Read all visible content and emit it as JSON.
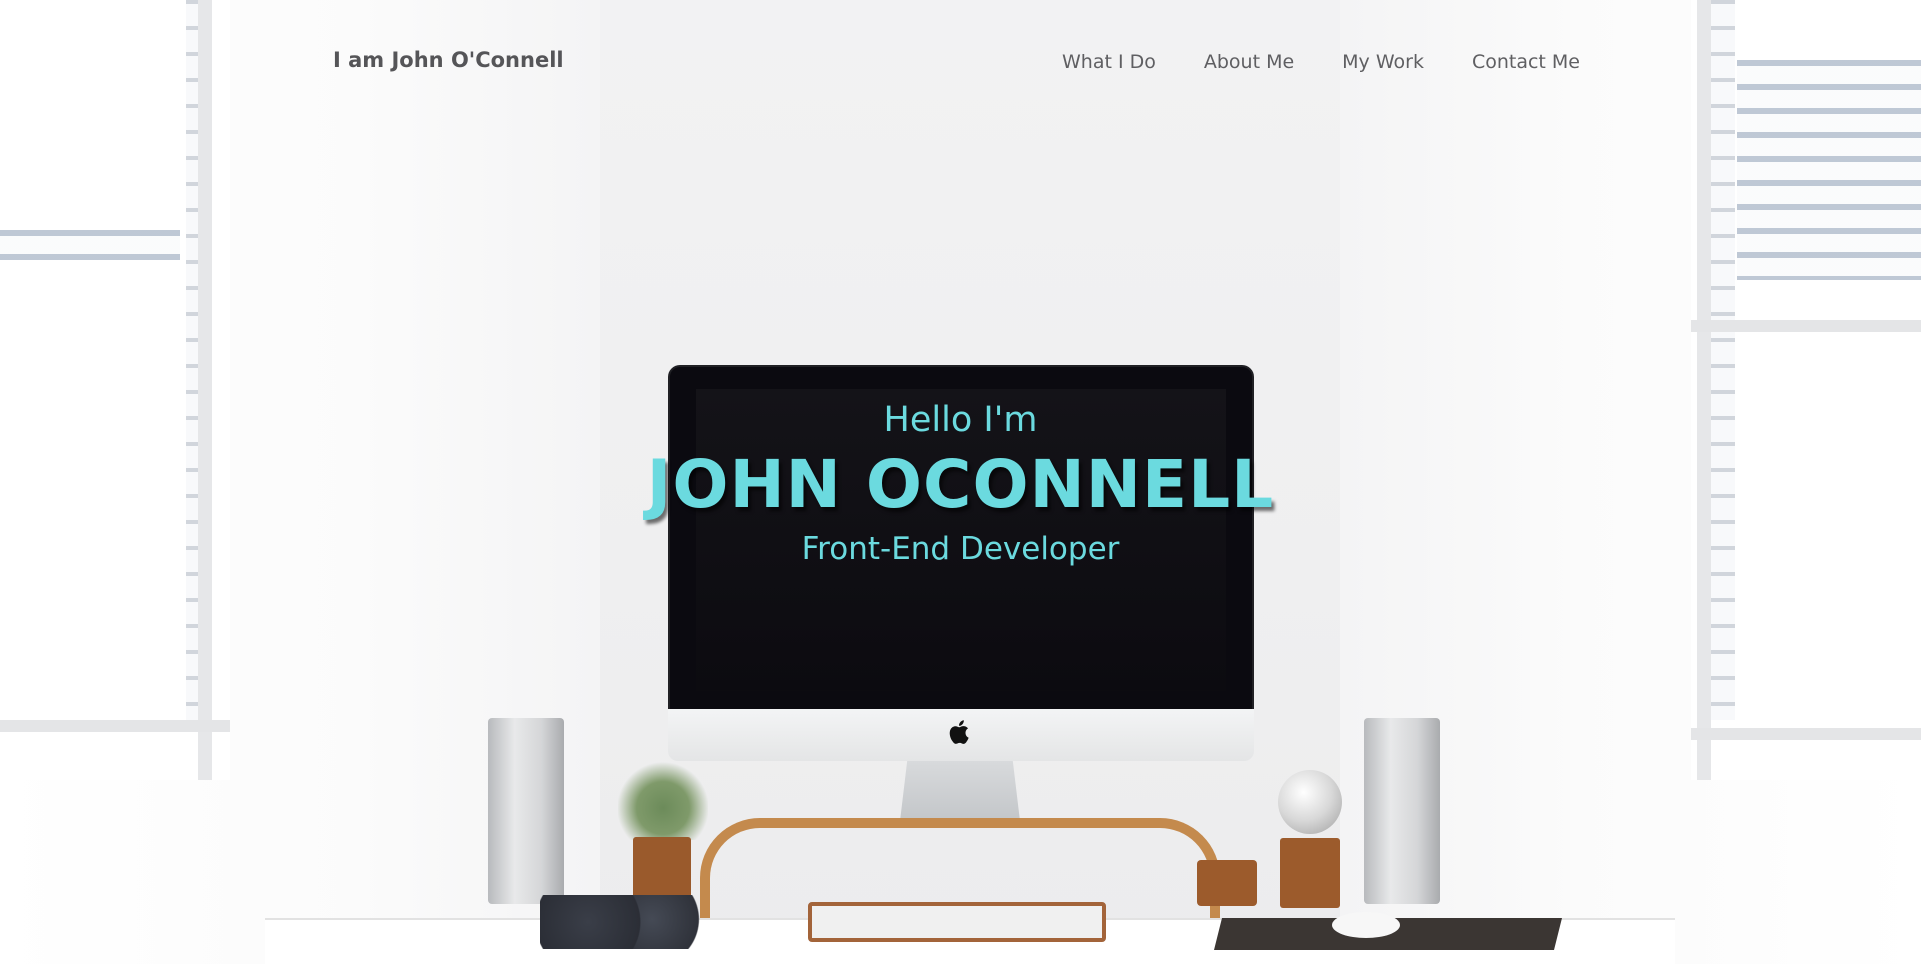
{
  "navbar": {
    "brand": "I am John O'Connell",
    "links": [
      {
        "label": "What I Do"
      },
      {
        "label": "About Me"
      },
      {
        "label": "My Work"
      },
      {
        "label": "Contact Me"
      }
    ]
  },
  "hero": {
    "greeting": "Hello I'm",
    "name": "JOHN OCONNELL",
    "role": "Front-End Developer"
  },
  "colors": {
    "accent": "#6bdadf",
    "nav_text": "#5f5f62",
    "brand_text": "#555558",
    "screen": "#0b0a10"
  },
  "icons": {
    "monitor_logo": "apple-logo-icon"
  }
}
